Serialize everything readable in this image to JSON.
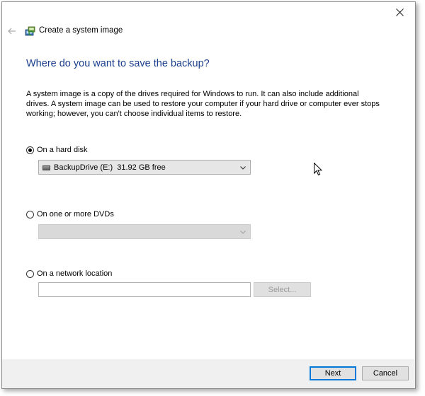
{
  "window": {
    "title": "Create a system image"
  },
  "page": {
    "heading": "Where do you want to save the backup?",
    "description": "A system image is a copy of the drives required for Windows to run. It can also include additional drives. A system image can be used to restore your computer if your hard drive or computer ever stops working; however, you can't choose individual items to restore."
  },
  "options": {
    "hard_disk": {
      "label": "On a hard disk",
      "selected": true,
      "dropdown_value": "BackupDrive (E:)  31.92 GB free"
    },
    "dvd": {
      "label": "On one or more DVDs",
      "selected": false,
      "dropdown_value": ""
    },
    "network": {
      "label": "On a network location",
      "selected": false,
      "input_value": "",
      "select_label": "Select..."
    }
  },
  "footer": {
    "next_label": "Next",
    "cancel_label": "Cancel"
  },
  "icons": {
    "close": "close-icon",
    "back": "back-arrow-icon",
    "app": "backup-restore-icon",
    "drive": "hard-drive-icon",
    "chevron": "chevron-down-icon",
    "cursor": "mouse-pointer-icon"
  },
  "colors": {
    "heading": "#1a3e8c",
    "primary_border": "#0078d7",
    "footer_bg": "#f0f0f0"
  }
}
